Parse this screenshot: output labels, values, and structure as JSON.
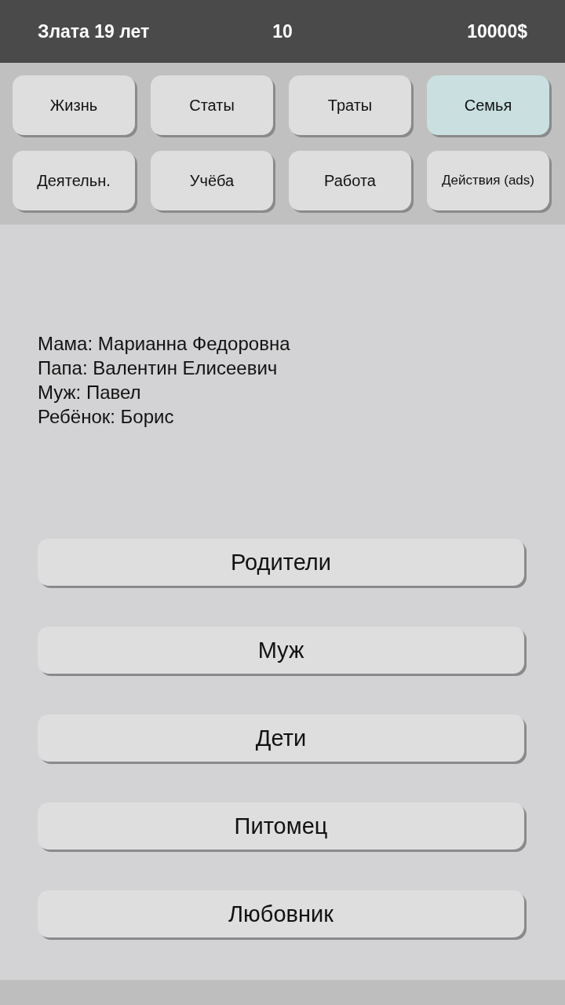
{
  "header": {
    "name_age": "Злата 19 лет",
    "counter": "10",
    "money": "10000$"
  },
  "tabs": [
    {
      "label": "Жизнь",
      "selected": false
    },
    {
      "label": "Статы",
      "selected": false
    },
    {
      "label": "Траты",
      "selected": false
    },
    {
      "label": "Семья",
      "selected": true
    },
    {
      "label": "Деятельн.",
      "selected": false
    },
    {
      "label": "Учёба",
      "selected": false
    },
    {
      "label": "Работа",
      "selected": false
    },
    {
      "label": "Действия (ads)",
      "selected": false
    }
  ],
  "family": [
    "Мама: Марианна Федоровна",
    "Папа: Валентин Елисеевич",
    "Муж: Павел",
    "Ребёнок: Борис"
  ],
  "actions": [
    "Родители",
    "Муж",
    "Дети",
    "Питомец",
    "Любовник"
  ]
}
